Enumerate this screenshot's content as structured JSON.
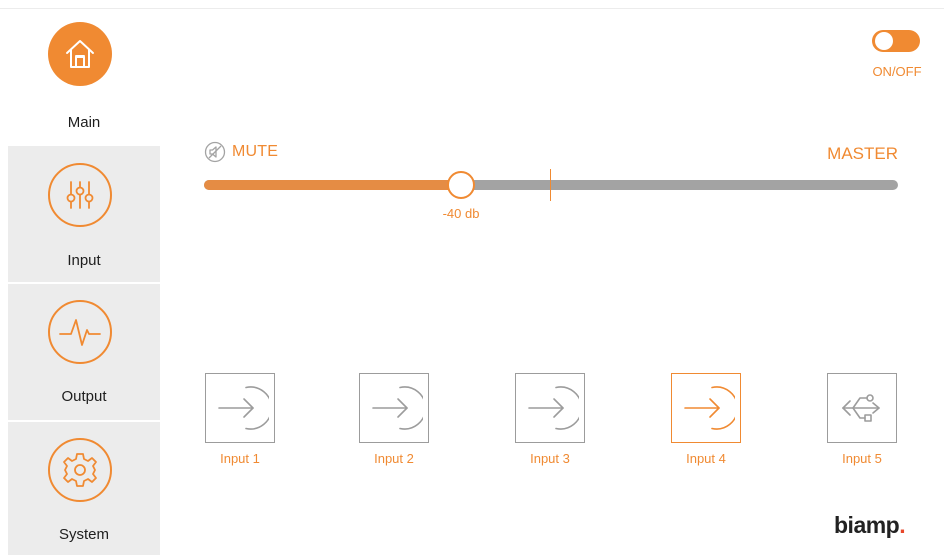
{
  "sidebar": {
    "items": [
      {
        "label": "Main",
        "icon": "home-icon",
        "active": true
      },
      {
        "label": "Input",
        "icon": "sliders-icon",
        "active": false
      },
      {
        "label": "Output",
        "icon": "waveform-icon",
        "active": false
      },
      {
        "label": "System",
        "icon": "gear-icon",
        "active": false
      }
    ]
  },
  "power": {
    "label": "ON/OFF",
    "state": "on"
  },
  "volume": {
    "mute_label": "MUTE",
    "master_label": "MASTER",
    "value_label": "-40 db",
    "level_fraction": 0.37
  },
  "inputs": [
    {
      "label": "Input 1",
      "icon": "input-arrow-icon",
      "selected": false
    },
    {
      "label": "Input 2",
      "icon": "input-arrow-icon",
      "selected": false
    },
    {
      "label": "Input 3",
      "icon": "input-arrow-icon",
      "selected": false
    },
    {
      "label": "Input 4",
      "icon": "input-arrow-icon",
      "selected": true
    },
    {
      "label": "Input 5",
      "icon": "usb-icon",
      "selected": false
    }
  ],
  "brand": {
    "name": "biamp",
    "dot": "."
  },
  "colors": {
    "accent": "#f08a32",
    "track": "#a3a3a3",
    "sidebar_bg": "#ececec",
    "logo_dot": "#e8472a"
  }
}
